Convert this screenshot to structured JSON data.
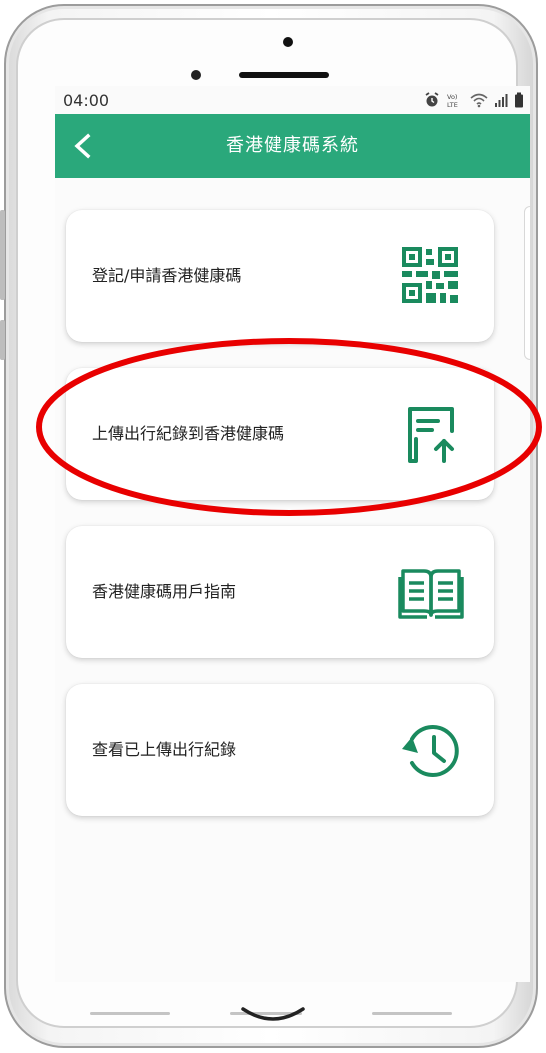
{
  "status_bar": {
    "time": "04:00",
    "icons": [
      "alarm-icon",
      "volte-icon",
      "wifi-icon",
      "signal-icon",
      "battery-icon"
    ]
  },
  "app_bar": {
    "title": "香港健康碼系統",
    "back_icon": "chevron-left-icon",
    "color": "#2aa87b"
  },
  "menu": {
    "items": [
      {
        "label": "登記/申請香港健康碼",
        "icon": "qr-code-icon"
      },
      {
        "label": "上傳出行紀錄到香港健康碼",
        "icon": "upload-document-icon"
      },
      {
        "label": "香港健康碼用戶指南",
        "icon": "open-book-icon"
      },
      {
        "label": "查看已上傳出行紀錄",
        "icon": "history-clock-icon"
      }
    ]
  },
  "colors": {
    "accent": "#2aa87b",
    "icon": "#1a8a5e",
    "annotation": "#e80000"
  }
}
